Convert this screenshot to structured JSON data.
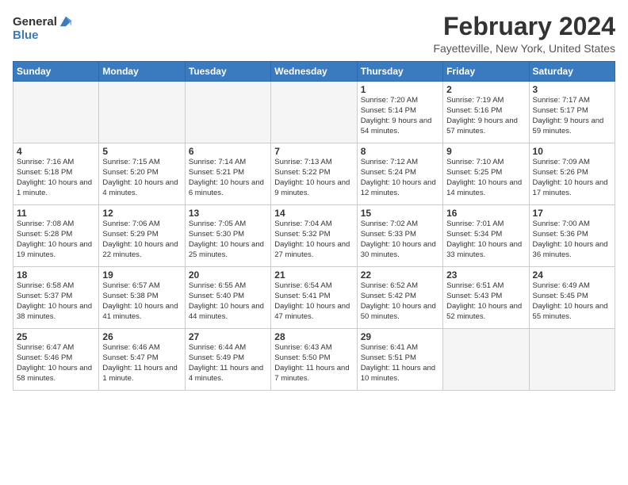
{
  "logo": {
    "general": "General",
    "blue": "Blue"
  },
  "title": "February 2024",
  "location": "Fayetteville, New York, United States",
  "weekdays": [
    "Sunday",
    "Monday",
    "Tuesday",
    "Wednesday",
    "Thursday",
    "Friday",
    "Saturday"
  ],
  "weeks": [
    [
      {
        "day": "",
        "sunrise": "",
        "sunset": "",
        "daylight": "",
        "empty": true
      },
      {
        "day": "",
        "sunrise": "",
        "sunset": "",
        "daylight": "",
        "empty": true
      },
      {
        "day": "",
        "sunrise": "",
        "sunset": "",
        "daylight": "",
        "empty": true
      },
      {
        "day": "",
        "sunrise": "",
        "sunset": "",
        "daylight": "",
        "empty": true
      },
      {
        "day": "1",
        "sunrise": "Sunrise: 7:20 AM",
        "sunset": "Sunset: 5:14 PM",
        "daylight": "Daylight: 9 hours and 54 minutes.",
        "empty": false
      },
      {
        "day": "2",
        "sunrise": "Sunrise: 7:19 AM",
        "sunset": "Sunset: 5:16 PM",
        "daylight": "Daylight: 9 hours and 57 minutes.",
        "empty": false
      },
      {
        "day": "3",
        "sunrise": "Sunrise: 7:17 AM",
        "sunset": "Sunset: 5:17 PM",
        "daylight": "Daylight: 9 hours and 59 minutes.",
        "empty": false
      }
    ],
    [
      {
        "day": "4",
        "sunrise": "Sunrise: 7:16 AM",
        "sunset": "Sunset: 5:18 PM",
        "daylight": "Daylight: 10 hours and 1 minute.",
        "empty": false
      },
      {
        "day": "5",
        "sunrise": "Sunrise: 7:15 AM",
        "sunset": "Sunset: 5:20 PM",
        "daylight": "Daylight: 10 hours and 4 minutes.",
        "empty": false
      },
      {
        "day": "6",
        "sunrise": "Sunrise: 7:14 AM",
        "sunset": "Sunset: 5:21 PM",
        "daylight": "Daylight: 10 hours and 6 minutes.",
        "empty": false
      },
      {
        "day": "7",
        "sunrise": "Sunrise: 7:13 AM",
        "sunset": "Sunset: 5:22 PM",
        "daylight": "Daylight: 10 hours and 9 minutes.",
        "empty": false
      },
      {
        "day": "8",
        "sunrise": "Sunrise: 7:12 AM",
        "sunset": "Sunset: 5:24 PM",
        "daylight": "Daylight: 10 hours and 12 minutes.",
        "empty": false
      },
      {
        "day": "9",
        "sunrise": "Sunrise: 7:10 AM",
        "sunset": "Sunset: 5:25 PM",
        "daylight": "Daylight: 10 hours and 14 minutes.",
        "empty": false
      },
      {
        "day": "10",
        "sunrise": "Sunrise: 7:09 AM",
        "sunset": "Sunset: 5:26 PM",
        "daylight": "Daylight: 10 hours and 17 minutes.",
        "empty": false
      }
    ],
    [
      {
        "day": "11",
        "sunrise": "Sunrise: 7:08 AM",
        "sunset": "Sunset: 5:28 PM",
        "daylight": "Daylight: 10 hours and 19 minutes.",
        "empty": false
      },
      {
        "day": "12",
        "sunrise": "Sunrise: 7:06 AM",
        "sunset": "Sunset: 5:29 PM",
        "daylight": "Daylight: 10 hours and 22 minutes.",
        "empty": false
      },
      {
        "day": "13",
        "sunrise": "Sunrise: 7:05 AM",
        "sunset": "Sunset: 5:30 PM",
        "daylight": "Daylight: 10 hours and 25 minutes.",
        "empty": false
      },
      {
        "day": "14",
        "sunrise": "Sunrise: 7:04 AM",
        "sunset": "Sunset: 5:32 PM",
        "daylight": "Daylight: 10 hours and 27 minutes.",
        "empty": false
      },
      {
        "day": "15",
        "sunrise": "Sunrise: 7:02 AM",
        "sunset": "Sunset: 5:33 PM",
        "daylight": "Daylight: 10 hours and 30 minutes.",
        "empty": false
      },
      {
        "day": "16",
        "sunrise": "Sunrise: 7:01 AM",
        "sunset": "Sunset: 5:34 PM",
        "daylight": "Daylight: 10 hours and 33 minutes.",
        "empty": false
      },
      {
        "day": "17",
        "sunrise": "Sunrise: 7:00 AM",
        "sunset": "Sunset: 5:36 PM",
        "daylight": "Daylight: 10 hours and 36 minutes.",
        "empty": false
      }
    ],
    [
      {
        "day": "18",
        "sunrise": "Sunrise: 6:58 AM",
        "sunset": "Sunset: 5:37 PM",
        "daylight": "Daylight: 10 hours and 38 minutes.",
        "empty": false
      },
      {
        "day": "19",
        "sunrise": "Sunrise: 6:57 AM",
        "sunset": "Sunset: 5:38 PM",
        "daylight": "Daylight: 10 hours and 41 minutes.",
        "empty": false
      },
      {
        "day": "20",
        "sunrise": "Sunrise: 6:55 AM",
        "sunset": "Sunset: 5:40 PM",
        "daylight": "Daylight: 10 hours and 44 minutes.",
        "empty": false
      },
      {
        "day": "21",
        "sunrise": "Sunrise: 6:54 AM",
        "sunset": "Sunset: 5:41 PM",
        "daylight": "Daylight: 10 hours and 47 minutes.",
        "empty": false
      },
      {
        "day": "22",
        "sunrise": "Sunrise: 6:52 AM",
        "sunset": "Sunset: 5:42 PM",
        "daylight": "Daylight: 10 hours and 50 minutes.",
        "empty": false
      },
      {
        "day": "23",
        "sunrise": "Sunrise: 6:51 AM",
        "sunset": "Sunset: 5:43 PM",
        "daylight": "Daylight: 10 hours and 52 minutes.",
        "empty": false
      },
      {
        "day": "24",
        "sunrise": "Sunrise: 6:49 AM",
        "sunset": "Sunset: 5:45 PM",
        "daylight": "Daylight: 10 hours and 55 minutes.",
        "empty": false
      }
    ],
    [
      {
        "day": "25",
        "sunrise": "Sunrise: 6:47 AM",
        "sunset": "Sunset: 5:46 PM",
        "daylight": "Daylight: 10 hours and 58 minutes.",
        "empty": false
      },
      {
        "day": "26",
        "sunrise": "Sunrise: 6:46 AM",
        "sunset": "Sunset: 5:47 PM",
        "daylight": "Daylight: 11 hours and 1 minute.",
        "empty": false
      },
      {
        "day": "27",
        "sunrise": "Sunrise: 6:44 AM",
        "sunset": "Sunset: 5:49 PM",
        "daylight": "Daylight: 11 hours and 4 minutes.",
        "empty": false
      },
      {
        "day": "28",
        "sunrise": "Sunrise: 6:43 AM",
        "sunset": "Sunset: 5:50 PM",
        "daylight": "Daylight: 11 hours and 7 minutes.",
        "empty": false
      },
      {
        "day": "29",
        "sunrise": "Sunrise: 6:41 AM",
        "sunset": "Sunset: 5:51 PM",
        "daylight": "Daylight: 11 hours and 10 minutes.",
        "empty": false
      },
      {
        "day": "",
        "sunrise": "",
        "sunset": "",
        "daylight": "",
        "empty": true
      },
      {
        "day": "",
        "sunrise": "",
        "sunset": "",
        "daylight": "",
        "empty": true
      }
    ]
  ]
}
